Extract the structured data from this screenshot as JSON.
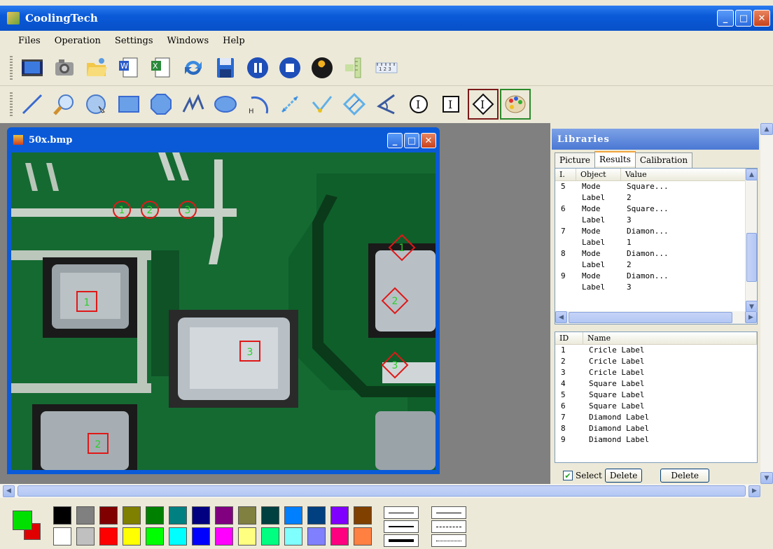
{
  "window": {
    "title": "CoolingTech"
  },
  "menu": [
    "Files",
    "Operation",
    "Settings",
    "Windows",
    "Help"
  ],
  "toolbar1_icons": [
    "capture-video-icon",
    "camera-icon",
    "open-folder-icon",
    "word-export-icon",
    "excel-export-icon",
    "refresh-icon",
    "save-icon",
    "pause-icon",
    "stop-icon",
    "tools-icon",
    "vertical-ruler-icon",
    "horizontal-ruler-icon"
  ],
  "toolbar2_icons": [
    "line-tool-icon",
    "zoom-tool-icon",
    "circle-tool-icon",
    "rectangle-tool-icon",
    "octagon-tool-icon",
    "polyline-tool-icon",
    "ellipse-tool-icon",
    "arc-tool-icon",
    "distance-tool-icon",
    "angle-tool-icon",
    "rotate-tool-icon",
    "angle-measure-icon",
    "circle-label-icon",
    "square-label-icon",
    "diamond-label-icon",
    "palette-icon"
  ],
  "image_window": {
    "title": "50x.bmp",
    "circle_labels": [
      "1",
      "2",
      "3"
    ],
    "square_labels": [
      "1",
      "2",
      "3"
    ],
    "diamond_labels": [
      "1",
      "2",
      "3"
    ]
  },
  "libraries": {
    "title": "Libraries",
    "tabs": [
      "Picture",
      "Results",
      "Calibration"
    ],
    "active_tab": "Results",
    "results_headers": [
      "I.",
      "Object",
      "Value"
    ],
    "results_rows": [
      [
        "5",
        "Mode",
        "Square..."
      ],
      [
        "",
        "Label",
        "2"
      ],
      [
        "6",
        "Mode",
        "Square..."
      ],
      [
        "",
        "Label",
        "3"
      ],
      [
        "7",
        "Mode",
        "Diamon..."
      ],
      [
        "",
        "Label",
        "1"
      ],
      [
        "8",
        "Mode",
        "Diamon..."
      ],
      [
        "",
        "Label",
        "2"
      ],
      [
        "9",
        "Mode",
        "Diamon..."
      ],
      [
        "",
        "Label",
        "3"
      ]
    ],
    "names_headers": [
      "ID",
      "Name"
    ],
    "names_rows": [
      [
        "1",
        "Cricle Label"
      ],
      [
        "2",
        "Cricle Label"
      ],
      [
        "3",
        "Cricle Label"
      ],
      [
        "4",
        "Square Label"
      ],
      [
        "5",
        "Square Label"
      ],
      [
        "6",
        "Square Label"
      ],
      [
        "7",
        "Diamond Label"
      ],
      [
        "8",
        "Diamond Label"
      ],
      [
        "9",
        "Diamond Label"
      ]
    ],
    "select_label": "Select",
    "select_checked": true,
    "delete_label_1": "Delete",
    "delete_label_2": "Delete"
  },
  "palette": {
    "foreground": "#00e000",
    "background": "#e00000",
    "colors_top": [
      "#000000",
      "#808080",
      "#800000",
      "#808000",
      "#008000",
      "#008080",
      "#000080",
      "#800080",
      "#808040",
      "#004040",
      "#0080ff",
      "#004080",
      "#8000ff",
      "#804000"
    ],
    "colors_bottom": [
      "#ffffff",
      "#c0c0c0",
      "#ff0000",
      "#ffff00",
      "#00ff00",
      "#00ffff",
      "#0000ff",
      "#ff00ff",
      "#ffff80",
      "#00ff80",
      "#80ffff",
      "#8080ff",
      "#ff0080",
      "#ff8040"
    ]
  }
}
